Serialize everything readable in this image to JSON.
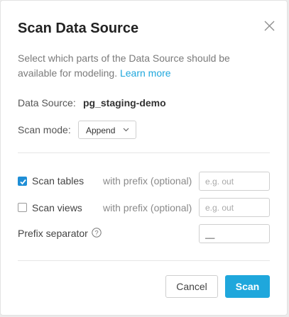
{
  "dialog": {
    "title": "Scan Data Source",
    "description": "Select which parts of the Data Source should be available for modeling.",
    "learn_more": "Learn more"
  },
  "data_source": {
    "label": "Data Source:",
    "value": "pg_staging-demo"
  },
  "scan_mode": {
    "label": "Scan mode:",
    "selected": "Append"
  },
  "options": {
    "scan_tables": {
      "label": "Scan tables",
      "checked": true,
      "prefix_hint": "with prefix (optional)",
      "placeholder": "e.g. out",
      "value": ""
    },
    "scan_views": {
      "label": "Scan views",
      "checked": false,
      "prefix_hint": "with prefix (optional)",
      "placeholder": "e.g. out",
      "value": ""
    },
    "prefix_separator": {
      "label": "Prefix separator",
      "value": "__"
    }
  },
  "buttons": {
    "cancel": "Cancel",
    "scan": "Scan"
  },
  "colors": {
    "accent": "#1fa7dc",
    "checkbox": "#1f8ed6"
  }
}
